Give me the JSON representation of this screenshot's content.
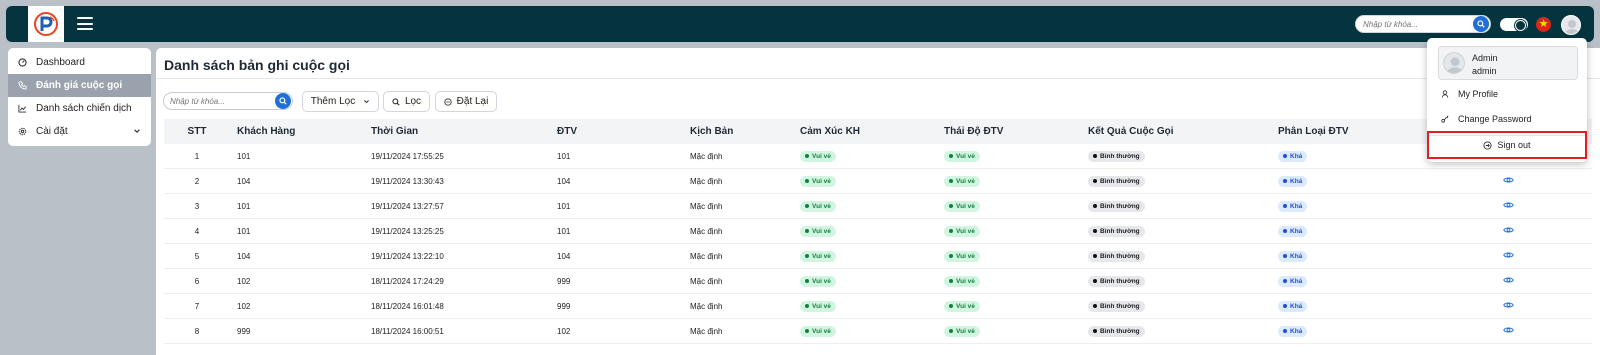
{
  "header": {
    "search_placeholder": "Nhập từ khóa..."
  },
  "sidebar": {
    "items": [
      {
        "label": "Dashboard",
        "icon": "dashboard-icon"
      },
      {
        "label": "Đánh giá cuộc gọi",
        "icon": "phone-icon",
        "active": true
      },
      {
        "label": "Danh sách chiến dịch",
        "icon": "chart-icon"
      },
      {
        "label": "Cài đặt",
        "icon": "gear-icon"
      }
    ]
  },
  "main": {
    "title": "Danh sách bản ghi cuộc gọi",
    "search_placeholder": "Nhập từ khóa...",
    "add_filter_label": "Thêm Lọc",
    "filter_label": "Lọc",
    "reset_label": "Đặt Lại"
  },
  "table": {
    "columns": [
      "STT",
      "Khách Hàng",
      "Thời Gian",
      "ĐTV",
      "Kịch Bản",
      "Cảm Xúc KH",
      "Thái Độ ĐTV",
      "Kết Quả Cuộc Gọi",
      "Phân Loại ĐTV"
    ],
    "rows": [
      {
        "stt": "1",
        "kh": "101",
        "tg": "19/11/2024 17:55:25",
        "dtv": "101",
        "kb": "Mặc định",
        "cx": "Vui vẻ",
        "td": "Vui vẻ",
        "kq": "Bình thường",
        "pl": "Khá"
      },
      {
        "stt": "2",
        "kh": "104",
        "tg": "19/11/2024 13:30:43",
        "dtv": "104",
        "kb": "Mặc định",
        "cx": "Vui vẻ",
        "td": "Vui vẻ",
        "kq": "Bình thường",
        "pl": "Khá"
      },
      {
        "stt": "3",
        "kh": "101",
        "tg": "19/11/2024 13:27:57",
        "dtv": "101",
        "kb": "Mặc định",
        "cx": "Vui vẻ",
        "td": "Vui vẻ",
        "kq": "Bình thường",
        "pl": "Khá"
      },
      {
        "stt": "4",
        "kh": "101",
        "tg": "19/11/2024 13:25:25",
        "dtv": "101",
        "kb": "Mặc định",
        "cx": "Vui vẻ",
        "td": "Vui vẻ",
        "kq": "Bình thường",
        "pl": "Khá"
      },
      {
        "stt": "5",
        "kh": "104",
        "tg": "19/11/2024 13:22:10",
        "dtv": "104",
        "kb": "Mặc định",
        "cx": "Vui vẻ",
        "td": "Vui vẻ",
        "kq": "Bình thường",
        "pl": "Khá"
      },
      {
        "stt": "6",
        "kh": "102",
        "tg": "18/11/2024 17:24:29",
        "dtv": "999",
        "kb": "Mặc định",
        "cx": "Vui vẻ",
        "td": "Vui vẻ",
        "kq": "Bình thường",
        "pl": "Khá"
      },
      {
        "stt": "7",
        "kh": "102",
        "tg": "18/11/2024 16:01:48",
        "dtv": "999",
        "kb": "Mặc định",
        "cx": "Vui vẻ",
        "td": "Vui vẻ",
        "kq": "Bình thường",
        "pl": "Khá"
      },
      {
        "stt": "8",
        "kh": "999",
        "tg": "18/11/2024 16:00:51",
        "dtv": "102",
        "kb": "Mặc định",
        "cx": "Vui vẻ",
        "td": "Vui vẻ",
        "kq": "Bình thường",
        "pl": "Khá"
      }
    ]
  },
  "user_menu": {
    "name": "Admin",
    "username": "admin",
    "my_profile_label": "My Profile",
    "change_password_label": "Change Password",
    "sign_out_label": "Sign out"
  },
  "colors": {
    "header_bg": "#05343f",
    "accent": "#1f6fd6",
    "highlight": "#e01e24"
  }
}
